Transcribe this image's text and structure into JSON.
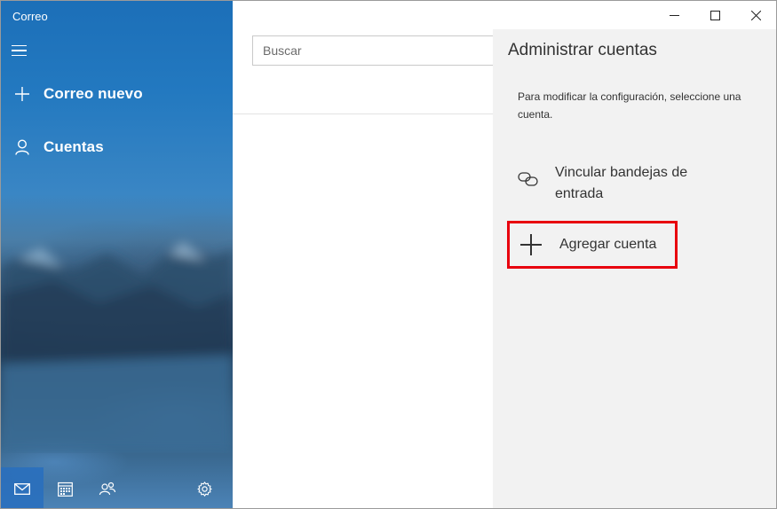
{
  "app": {
    "title": "Correo"
  },
  "sidebar": {
    "menu_icon": "hamburger-icon",
    "items": [
      {
        "label": "Correo nuevo",
        "icon": "plus-icon"
      },
      {
        "label": "Cuentas",
        "icon": "person-icon"
      }
    ],
    "bottom": [
      "mail-icon",
      "calendar-icon",
      "people-icon",
      "gear-icon"
    ]
  },
  "window_controls": {
    "minimize": "—",
    "maximize": "☐",
    "close": "✕"
  },
  "search": {
    "placeholder": "Buscar"
  },
  "panel": {
    "title": "Administrar cuentas",
    "description": "Para modificar la configuración, seleccione una cuenta.",
    "link_inboxes": "Vincular bandejas de entrada",
    "add_account": "Agregar cuenta"
  },
  "colors": {
    "highlight_border": "#e8000e",
    "sidebar_top": "#1c6fb8",
    "panel_bg": "#f2f2f2"
  }
}
